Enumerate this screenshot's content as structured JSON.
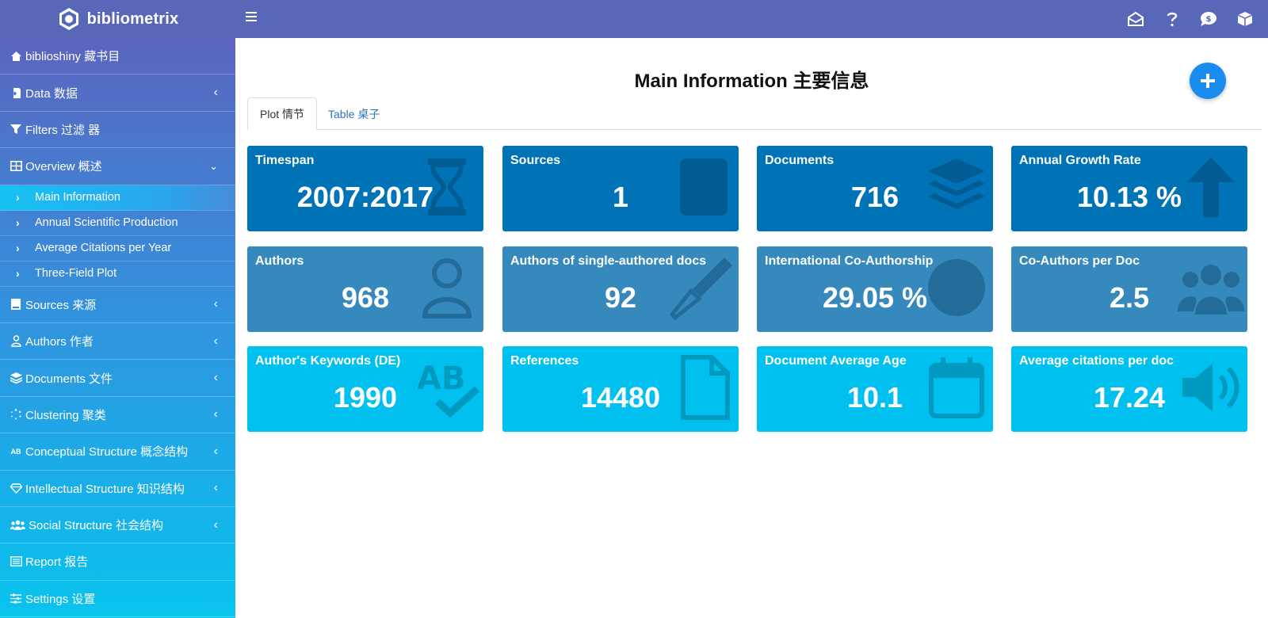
{
  "app": {
    "name": "bibliometrix"
  },
  "header": {
    "icons": [
      "envelope-icon",
      "question-icon",
      "dollar-comment-icon",
      "cube-icon"
    ]
  },
  "sidebar": {
    "items": [
      {
        "label": "biblioshiny 藏书目",
        "icon": "home-icon"
      },
      {
        "label": "Data 数据",
        "icon": "file-import-icon"
      },
      {
        "label": "Filters 过滤 器",
        "icon": "filter-icon"
      },
      {
        "label": "Overview 概述",
        "icon": "table-icon"
      },
      {
        "label": "Sources 来源",
        "icon": "book-icon"
      },
      {
        "label": "Authors 作者",
        "icon": "user-icon"
      },
      {
        "label": "Documents 文件",
        "icon": "layers-icon"
      },
      {
        "label": "Clustering 聚类",
        "icon": "spinner-icon"
      },
      {
        "label": "Conceptual Structure 概念结构",
        "icon": "spell-check-icon"
      },
      {
        "label": "Intellectual Structure 知识结构",
        "icon": "gem-icon"
      },
      {
        "label": "Social Structure 社会结构",
        "icon": "users-icon"
      },
      {
        "label": "Report 报告",
        "icon": "list-icon"
      },
      {
        "label": "Settings 设置",
        "icon": "sliders-icon"
      }
    ],
    "overview_sub": [
      {
        "label": "Main Information"
      },
      {
        "label": "Annual Scientific Production"
      },
      {
        "label": "Average Citations per Year"
      },
      {
        "label": "Three-Field Plot"
      }
    ]
  },
  "main": {
    "title": "Main Information 主要信息",
    "tabs": [
      {
        "label": "Plot 情节"
      },
      {
        "label": "Table 桌子"
      }
    ],
    "cards": [
      {
        "label": "Timespan",
        "value": "2007:2017",
        "icon": "hourglass-icon"
      },
      {
        "label": "Sources",
        "value": "1",
        "icon": "book-icon"
      },
      {
        "label": "Documents",
        "value": "716",
        "icon": "layers-icon"
      },
      {
        "label": "Annual Growth Rate",
        "value": "10.13 %",
        "icon": "arrow-up-icon"
      },
      {
        "label": "Authors",
        "value": "968",
        "icon": "user-icon"
      },
      {
        "label": "Authors of single-authored docs",
        "value": "92",
        "icon": "pen-nib-icon"
      },
      {
        "label": "International Co-Authorship",
        "value": "29.05 %",
        "icon": "globe-icon"
      },
      {
        "label": "Co-Authors per Doc",
        "value": "2.5",
        "icon": "users-icon"
      },
      {
        "label": "Author's Keywords (DE)",
        "value": "1990",
        "icon": "spell-check-icon"
      },
      {
        "label": "References",
        "value": "14480",
        "icon": "file-icon"
      },
      {
        "label": "Document Average Age",
        "value": "10.1",
        "icon": "calendar-icon"
      },
      {
        "label": "Average citations per doc",
        "value": "17.24",
        "icon": "volume-icon"
      }
    ]
  },
  "colors": {
    "header": "#5967b8",
    "row1": "#0073b6",
    "row2": "#3689bd",
    "row3": "#00c0ef",
    "fab": "#1a8cf0"
  }
}
